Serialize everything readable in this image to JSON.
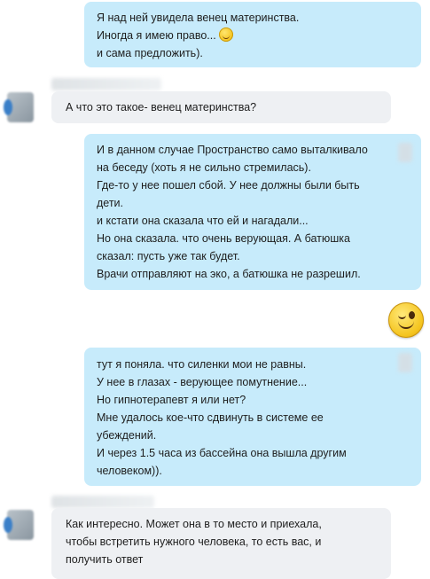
{
  "messages": [
    {
      "lines": [
        "Я над ней увидела венец материнства.",
        "Иногда я имею право...",
        "и сама предложить)."
      ],
      "emoji": "smile-emoticon"
    },
    {
      "lines": [
        "А что это такое- венец материнства?"
      ]
    },
    {
      "lines": [
        "И в данном случае Пространство само выталкивало",
        "на беседу (хоть я не сильно стремилась).",
        "Где-то у нее пошел сбой. У нее должны были быть",
        "дети.",
        "и кстати она сказала что ей и нагадали...",
        "Но она сказала. что очень верующая. А батюшка",
        "сказал: пусть уже так будет.",
        "Врачи отправляют на эко, а батюшка не разрешил."
      ]
    },
    {
      "emoji": "wink-emoticon"
    },
    {
      "lines": [
        "тут я поняла. что силенки мои не равны.",
        "У нее в глазах - верующее помутнение...",
        "Но гипнотерапевт я или нет?",
        "Мне удалось кое-что сдвинуть в системе ее",
        "убеждений.",
        "И через 1.5 часа из бассейна она вышла другим",
        "человеком))."
      ]
    },
    {
      "lines": [
        "Как интересно.  Может она в то место и приехала,",
        "чтобы встретить нужного человека, то есть вас, и",
        "получить ответ"
      ]
    }
  ]
}
